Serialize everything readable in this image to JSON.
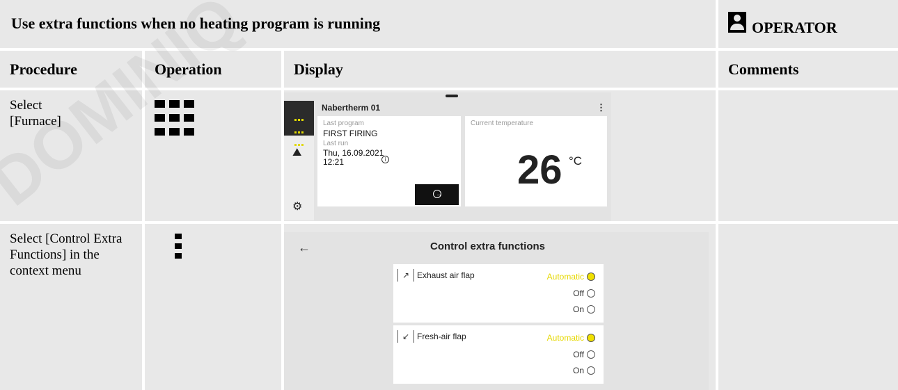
{
  "title": "Use extra functions when no heating program is running",
  "role": "OPERATOR",
  "watermark": "DOMINIQ",
  "headers": {
    "procedure": "Procedure",
    "operation": "Operation",
    "display": "Display",
    "comments": "Comments"
  },
  "rows": [
    {
      "procedure": "Select [Furnace]",
      "operation_icon": "grid-3x3-icon",
      "comments": "",
      "screen": {
        "device_name": "Nabertherm 01",
        "menu_icon": "kebab-icon",
        "sidebar": [
          "grid-icon",
          "chart-icon",
          "gear-icon"
        ],
        "last_program_label": "Last program",
        "last_program": "FIRST FIRING",
        "last_run_label": "Last run",
        "last_run_date": "Thu, 16.09.2021",
        "last_run_time": "12:21",
        "current_temp_label": "Current temperature",
        "current_temp": "26",
        "temp_unit": "°C",
        "accent": "#e0d800"
      }
    },
    {
      "procedure": "Select [Control Extra Functions] in the context menu",
      "operation_icon": "vertical-dots-icon",
      "comments": "",
      "screen": {
        "title": "Control extra functions",
        "flaps": [
          {
            "name": "Exhaust air flap",
            "options": [
              "Automatic",
              "Off",
              "On"
            ],
            "selected": "Automatic"
          },
          {
            "name": "Fresh-air flap",
            "options": [
              "Automatic",
              "Off",
              "On"
            ],
            "selected": "Automatic"
          }
        ],
        "accent": "#e6d800"
      }
    }
  ]
}
